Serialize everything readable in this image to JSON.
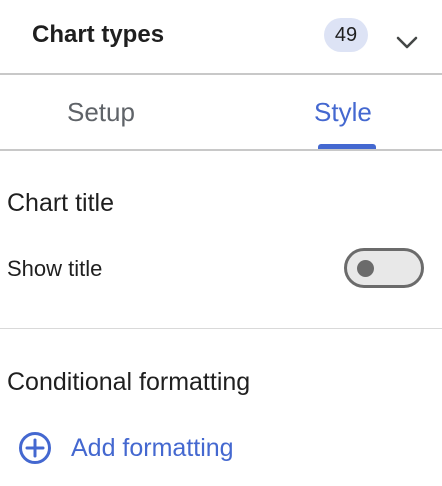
{
  "header": {
    "title": "Chart types",
    "count": "49"
  },
  "tabs": [
    {
      "label": "Setup",
      "active": false
    },
    {
      "label": "Style",
      "active": true
    }
  ],
  "chart_title_section": {
    "title": "Chart title",
    "show_title_label": "Show title",
    "show_title_enabled": false
  },
  "conditional_section": {
    "title": "Conditional formatting",
    "add_label": "Add formatting"
  },
  "icons": {
    "chevron": "chevron-down-icon",
    "add": "add-circle-icon"
  },
  "colors": {
    "accent": "#4468d0",
    "badge_bg": "#dde3f5",
    "toggle_off": "#6b6b6b"
  }
}
